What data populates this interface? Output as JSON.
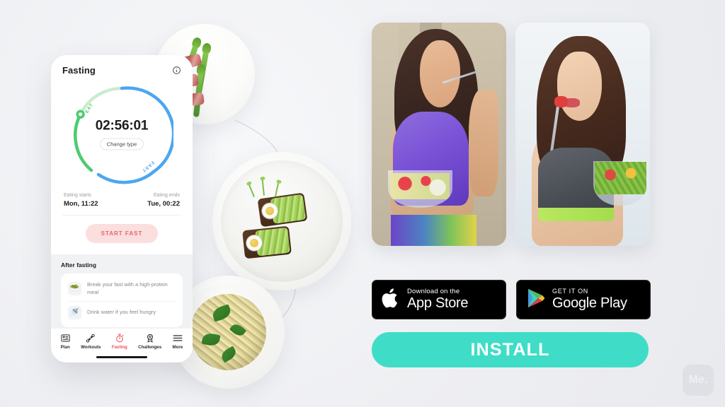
{
  "background_color": "#eeeff2",
  "phone": {
    "fasting_card": {
      "title": "Fasting",
      "info_icon": "info-circle-icon",
      "timer_value": "02:56:01",
      "change_type_label": "Change type",
      "ring": {
        "eat_label": "EAT",
        "fast_label": "FAST",
        "eat_color": "#4ecb71",
        "fast_color": "#4da6f0",
        "handle_color": "#4ecb71"
      },
      "eating_starts_label": "Eating starts",
      "eating_starts_value": "Mon, 11:22",
      "eating_ends_label": "Eating ends",
      "eating_ends_value": "Tue, 00:22",
      "start_button_label": "START FAST",
      "start_button_bg": "#fbdede",
      "start_button_color": "#e8636d"
    },
    "after_fasting": {
      "title": "After fasting",
      "tips": [
        {
          "icon": "salad-bowl-icon",
          "glyph": "🥗",
          "text": "Break your fast with a high-protein meal"
        },
        {
          "icon": "water-faucet-icon",
          "glyph": "🚿",
          "text": "Drink water if you feel hungry"
        }
      ]
    },
    "tabbar": {
      "active_color": "#ef4d54",
      "items": [
        {
          "label": "Plan",
          "icon": "plan-card-icon",
          "active": false
        },
        {
          "label": "Workouts",
          "icon": "dumbbell-icon",
          "active": false
        },
        {
          "label": "Fasting",
          "icon": "stopwatch-icon",
          "active": true
        },
        {
          "label": "Challenges",
          "icon": "trophy-medal-icon",
          "active": false
        },
        {
          "label": "More",
          "icon": "hamburger-menu-icon",
          "active": false
        }
      ]
    }
  },
  "food_photos": [
    {
      "name": "bacon-wrapped-asparagus-photo"
    },
    {
      "name": "avocado-egg-toast-photo"
    },
    {
      "name": "pesto-pasta-basil-photo"
    }
  ],
  "lifestyle_photos": [
    {
      "name": "woman-purple-top-eating-salad-photo"
    },
    {
      "name": "woman-grey-sportsbra-salad-bowl-photo"
    }
  ],
  "store_badges": [
    {
      "icon": "apple-logo-icon",
      "small_text": "Download on the",
      "big_text": "App Store"
    },
    {
      "icon": "google-play-triangle-icon",
      "small_text": "GET IT ON",
      "big_text": "Google Play"
    }
  ],
  "install_button": {
    "label": "INSTALL",
    "color": "#3fddc7"
  },
  "watermark": {
    "text": "Me."
  }
}
